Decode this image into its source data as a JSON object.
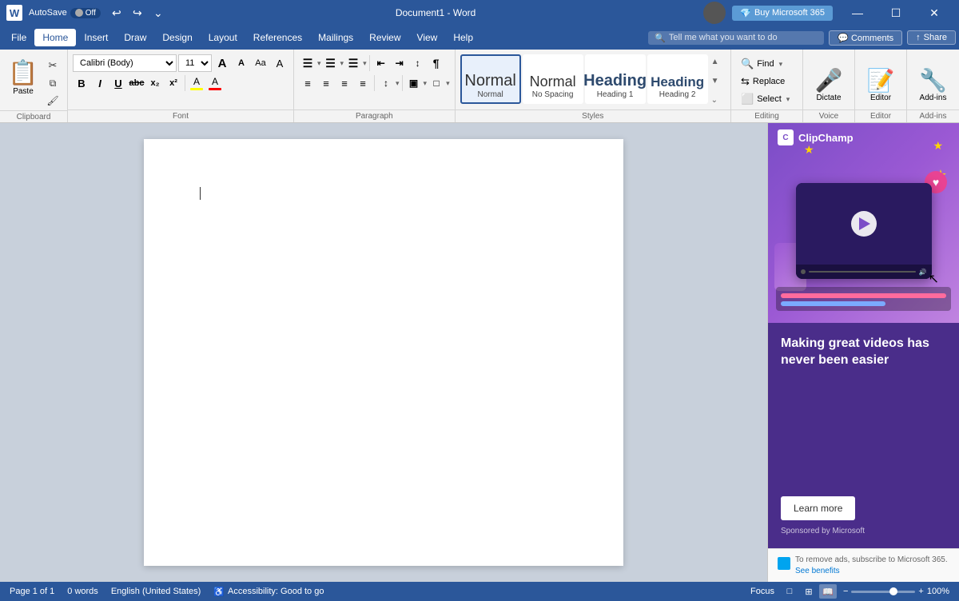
{
  "titleBar": {
    "logo": "W",
    "autosave": "AutoSave",
    "autosaveState": "Off",
    "undoLabel": "↩",
    "redoLabel": "↪",
    "moreLabel": "⌄",
    "documentTitle": "Document1 - Word",
    "buyLabel": "Buy Microsoft 365",
    "minimizeLabel": "—",
    "maximizeLabel": "☐",
    "closeLabel": "✕"
  },
  "menuBar": {
    "items": [
      "File",
      "Home",
      "Insert",
      "Draw",
      "Design",
      "Layout",
      "References",
      "Mailings",
      "Review",
      "View",
      "Help"
    ],
    "activeItem": "Home",
    "searchPlaceholder": "Tell me what you want to do",
    "commentsLabel": "💬 Comments",
    "shareLabel": "Share"
  },
  "ribbon": {
    "clipboard": {
      "pasteLabel": "Paste",
      "cutLabel": "✂",
      "copyLabel": "⧉",
      "formatPainterLabel": "🖌",
      "groupLabel": "Clipboard"
    },
    "font": {
      "fontName": "Calibri (Body)",
      "fontSize": "11",
      "growLabel": "A",
      "shrinkLabel": "A",
      "clearLabel": "A",
      "caseLabel": "Aa",
      "highlightLabel": "A",
      "boldLabel": "B",
      "italicLabel": "I",
      "underlineLabel": "U",
      "strikeLabel": "abc",
      "subscriptLabel": "x₂",
      "superscriptLabel": "x²",
      "fontColorLabel": "A",
      "groupLabel": "Font"
    },
    "paragraph": {
      "bulletLabel": "≡",
      "numberedLabel": "≡",
      "multiListLabel": "≡",
      "decreaseIndentLabel": "←",
      "increaseIndentLabel": "→",
      "sortLabel": "↕",
      "showHideLabel": "¶",
      "alignLeftLabel": "≡",
      "alignCenterLabel": "≡",
      "alignRightLabel": "≡",
      "justifyLabel": "≡",
      "lineSpacingLabel": "↕",
      "shadingLabel": "▣",
      "bordersLabel": "□",
      "groupLabel": "Paragraph"
    },
    "styles": {
      "items": [
        {
          "label": "Normal",
          "previewClass": "normal"
        },
        {
          "label": "No Spacing",
          "previewClass": "normal"
        },
        {
          "label": "Heading 1",
          "previewClass": "heading1"
        },
        {
          "label": "Heading 2",
          "previewClass": "heading2"
        }
      ],
      "activeStyle": "Normal",
      "groupLabel": "Styles"
    },
    "editing": {
      "findLabel": "Find",
      "replaceLabel": "Replace",
      "selectLabel": "Select",
      "groupLabel": "Editing"
    },
    "voice": {
      "dictateLabel": "Dictate",
      "groupLabel": "Voice"
    },
    "editor": {
      "label": "Editor",
      "groupLabel": "Editor"
    },
    "addins": {
      "label": "Add-ins",
      "groupLabel": "Add-ins"
    }
  },
  "document": {
    "content": ""
  },
  "adPanel": {
    "appName": "ClipChamp",
    "tagline": "Making great videos has never been easier",
    "learnMoreLabel": "Learn more",
    "sponsoredLabel": "Sponsored by Microsoft",
    "footerText": "To remove ads, subscribe to Microsoft 365.",
    "seeBenefitsLabel": "See benefits"
  },
  "statusBar": {
    "pageInfo": "Page 1 of 1",
    "wordCount": "0 words",
    "language": "English (United States)",
    "accessibility": "Accessibility: Good to go",
    "focusLabel": "Focus",
    "zoomLevel": "100%"
  }
}
